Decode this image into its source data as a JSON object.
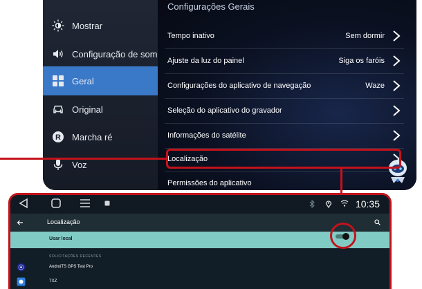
{
  "unit": {
    "sidebar": [
      {
        "label": "Mostrar",
        "icon": "brightness-icon"
      },
      {
        "label": "Configuração de som",
        "icon": "speaker-icon"
      },
      {
        "label": "Geral",
        "icon": "grid-icon",
        "active": true
      },
      {
        "label": "Original",
        "icon": "car-icon"
      },
      {
        "label": "Marcha ré",
        "icon": "reverse-icon"
      },
      {
        "label": "Voz",
        "icon": "microphone-icon"
      }
    ],
    "header": "Configurações Gerais",
    "rows": [
      {
        "label": "Tempo inativo",
        "value": "Sem dormir"
      },
      {
        "label": "Ajuste da luz do painel",
        "value": "Siga os faróis"
      },
      {
        "label": "Configurações do aplicativo de navegação",
        "value": "Waze"
      },
      {
        "label": "Seleção do aplicativo do gravador",
        "value": ""
      },
      {
        "label": "Informações do satélite",
        "value": ""
      },
      {
        "label": "Localização",
        "value": ""
      },
      {
        "label": "Permissões do aplicativo",
        "value": ""
      }
    ]
  },
  "android": {
    "time": "10:35",
    "title": "Localização",
    "use_location": "Usar local",
    "use_location_on": true,
    "section": "SOLICITAÇÕES RECENTES",
    "apps": [
      {
        "name": "AndroiTS GPS Test Pro",
        "icon": "gps-app-icon"
      },
      {
        "name": "TXZ",
        "icon": "txz-app-icon"
      }
    ]
  },
  "colors": {
    "highlight": "#c4121b",
    "active_item": "#3a78c8",
    "use_location_bg": "#80cbc4"
  }
}
